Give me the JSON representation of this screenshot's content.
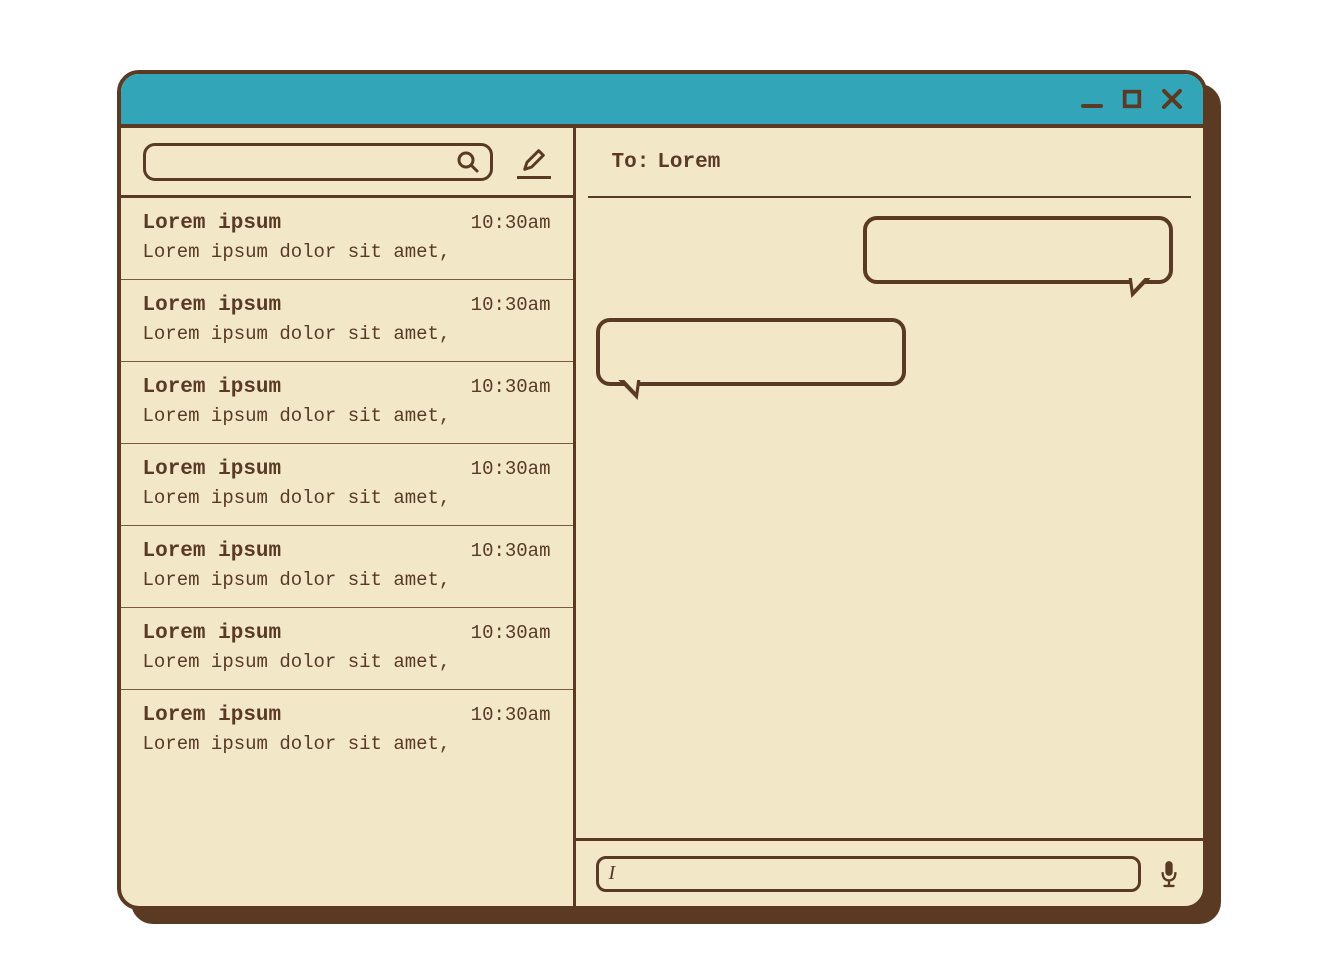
{
  "titlebar": {
    "minimize": "minimize",
    "maximize": "maximize",
    "close": "close"
  },
  "sidebar": {
    "search_placeholder": "",
    "conversations": [
      {
        "name": "Lorem ipsum",
        "time": "10:30am",
        "preview": "Lorem ipsum dolor sit amet,"
      },
      {
        "name": "Lorem ipsum",
        "time": "10:30am",
        "preview": "Lorem ipsum dolor sit amet,"
      },
      {
        "name": "Lorem ipsum",
        "time": "10:30am",
        "preview": "Lorem ipsum dolor sit amet,"
      },
      {
        "name": "Lorem ipsum",
        "time": "10:30am",
        "preview": "Lorem ipsum dolor sit amet,"
      },
      {
        "name": "Lorem ipsum",
        "time": "10:30am",
        "preview": "Lorem ipsum dolor sit amet,"
      },
      {
        "name": "Lorem ipsum",
        "time": "10:30am",
        "preview": "Lorem ipsum dolor sit amet,"
      },
      {
        "name": "Lorem ipsum",
        "time": "10:30am",
        "preview": "Lorem ipsum dolor sit amet,"
      }
    ]
  },
  "chat": {
    "to_label": "To:",
    "to_name": "Lorem",
    "messages": [
      {
        "direction": "out",
        "text": ""
      },
      {
        "direction": "in",
        "text": ""
      }
    ],
    "input_value": "",
    "cursor_char": "I"
  },
  "colors": {
    "titlebar": "#33a5b8",
    "border": "#5a3a23",
    "background": "#f2e8c8"
  }
}
